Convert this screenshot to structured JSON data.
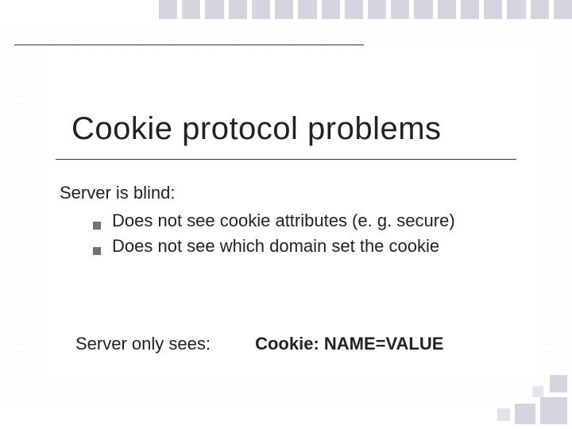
{
  "title": "Cookie protocol problems",
  "lead": "Server is blind:",
  "bullets": [
    "Does not see cookie attributes  (e. g. secure)",
    "Does not see which domain set the cookie"
  ],
  "footer": {
    "label": "Server only sees:",
    "value": "Cookie:  NAME=VALUE"
  },
  "decor": {
    "top_square_color": "#d5d5e0",
    "bullet_color": "#6a7a66"
  }
}
